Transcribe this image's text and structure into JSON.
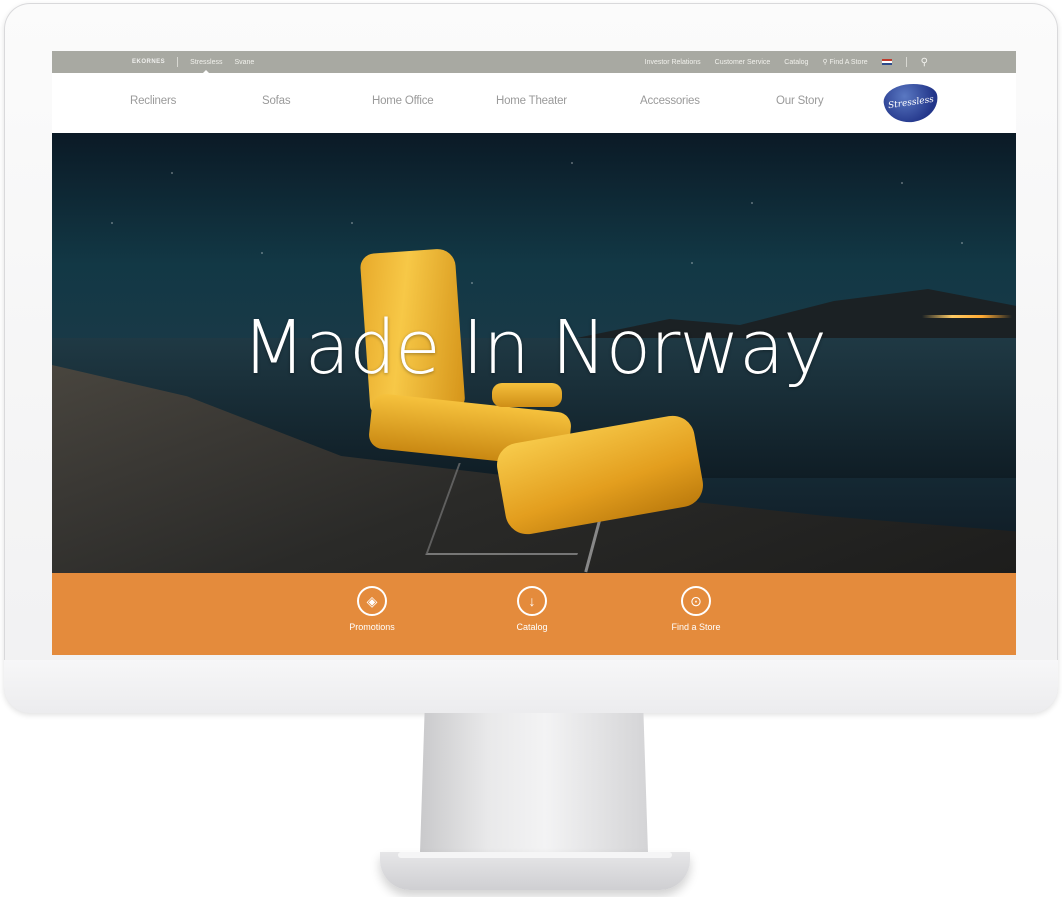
{
  "utility_bar": {
    "brand": "EKORNES",
    "links_left": [
      "Stressless",
      "Svane"
    ],
    "links_right": [
      "Investor Relations",
      "Customer Service",
      "Catalog",
      "Find A Store"
    ]
  },
  "main_nav": {
    "items": [
      "Recliners",
      "Sofas",
      "Home Office",
      "Home Theater",
      "Accessories",
      "Our Story"
    ],
    "logo_text": "Stressless"
  },
  "hero": {
    "title": "Made In Norway"
  },
  "quick_links": [
    {
      "label": "Promotions",
      "icon": "tag-icon"
    },
    {
      "label": "Catalog",
      "icon": "download-arrow-icon"
    },
    {
      "label": "Find a Store",
      "icon": "map-pin-icon"
    }
  ],
  "colors": {
    "utility_bg": "#a8a9a2",
    "accent_orange": "#e48b3c",
    "logo_blue": "#23368a"
  }
}
